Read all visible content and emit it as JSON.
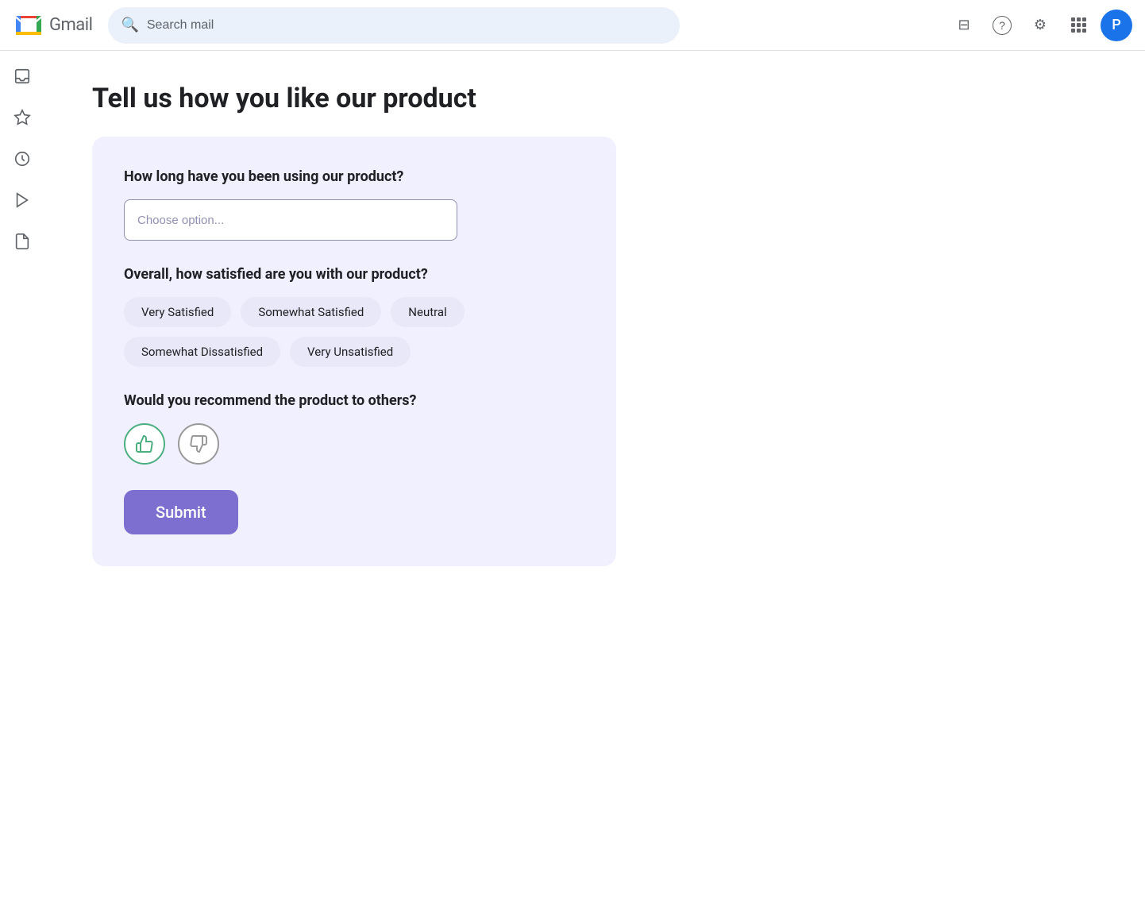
{
  "topbar": {
    "logo_text": "Gmail",
    "search_placeholder": "Search mail",
    "help_icon": "?",
    "settings_icon": "⚙",
    "apps_icon": "⋮⋮⋮",
    "avatar_initial": "P"
  },
  "sidebar": {
    "items": [
      {
        "icon": "inbox",
        "label": "Inbox",
        "unicode": "☐"
      },
      {
        "icon": "star",
        "label": "Starred",
        "unicode": "☆"
      },
      {
        "icon": "clock",
        "label": "Snoozed",
        "unicode": "○"
      },
      {
        "icon": "send",
        "label": "Sent",
        "unicode": "▷"
      },
      {
        "icon": "draft",
        "label": "Drafts",
        "unicode": "☐"
      }
    ]
  },
  "page": {
    "title": "Tell us how you like our product",
    "survey": {
      "question1": {
        "label": "How long have you been using our product?",
        "dropdown_placeholder": "Choose option..."
      },
      "question2": {
        "label": "Overall, how satisfied are you with our product?",
        "options": [
          {
            "id": "very-satisfied",
            "label": "Very Satisfied"
          },
          {
            "id": "somewhat-satisfied",
            "label": "Somewhat Satisfied"
          },
          {
            "id": "neutral",
            "label": "Neutral"
          },
          {
            "id": "somewhat-dissatisfied",
            "label": "Somewhat Dissatisfied"
          },
          {
            "id": "very-unsatisfied",
            "label": "Very Unsatisfied"
          }
        ]
      },
      "question3": {
        "label": "Would you recommend the product to others?",
        "thumbs_up_icon": "👍",
        "thumbs_down_icon": "👎"
      },
      "submit_label": "Submit"
    }
  }
}
